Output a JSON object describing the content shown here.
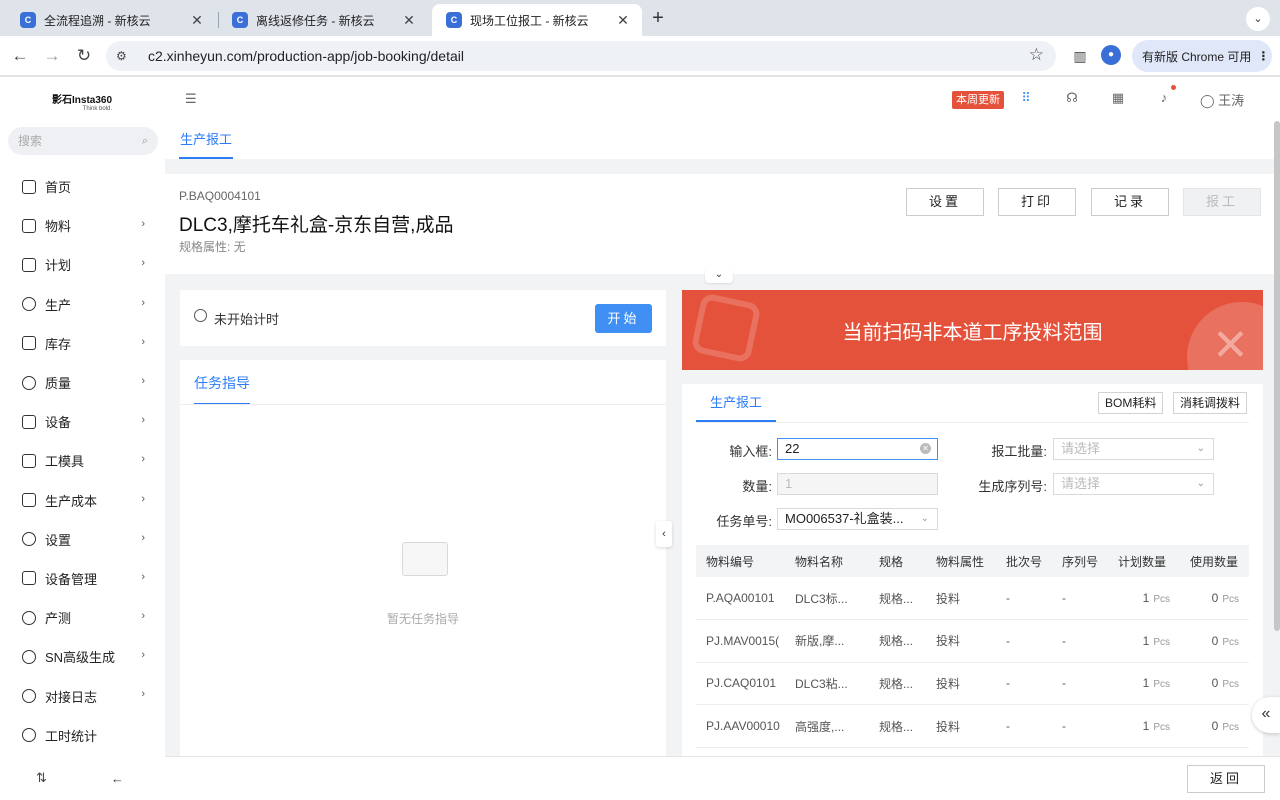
{
  "browser": {
    "tabs": [
      {
        "title": "全流程追溯 - 新核云"
      },
      {
        "title": "离线返修任务 - 新核云"
      },
      {
        "title": "现场工位报工 - 新核云",
        "active": true
      }
    ],
    "url": "c2.xinheyun.com/production-app/job-booking/detail",
    "update_chip": "有新版 Chrome 可用"
  },
  "app": {
    "logo": "影石Insta360",
    "logo_tagline": "Think bold.",
    "search_placeholder": "搜索",
    "menu": [
      {
        "label": "首页",
        "icon": "home-icon"
      },
      {
        "label": "物料",
        "icon": "material-icon"
      },
      {
        "label": "计划",
        "icon": "plan-icon"
      },
      {
        "label": "生产",
        "icon": "wrench-icon"
      },
      {
        "label": "库存",
        "icon": "warehouse-icon"
      },
      {
        "label": "质量",
        "icon": "shield-icon"
      },
      {
        "label": "设备",
        "icon": "device-icon"
      },
      {
        "label": "工模具",
        "icon": "tool-icon"
      },
      {
        "label": "生产成本",
        "icon": "cost-icon"
      },
      {
        "label": "设置",
        "icon": "gear-icon"
      },
      {
        "label": "设备管理",
        "icon": "device-mgmt-icon"
      },
      {
        "label": "产测",
        "icon": "test-icon"
      },
      {
        "label": "SN高级生成",
        "icon": "sn-icon"
      },
      {
        "label": "对接日志",
        "icon": "log-icon"
      },
      {
        "label": "工时统计",
        "icon": "clock-icon"
      }
    ],
    "week_update": "本周更新",
    "user_name": "王涛"
  },
  "page": {
    "tab": "生产报工",
    "product_code": "P.BAQ0004101",
    "product_title": "DLC3,摩托车礼盒-京东自营,成品",
    "spec": "规格属性: 无",
    "buttons": {
      "settings": "设置",
      "print": "打印",
      "record": "记录",
      "report": "报工"
    },
    "timer_label": "未开始计时",
    "start_button": "开始",
    "guide_tab": "任务指导",
    "guide_empty": "暂无任务指导",
    "error_message": "当前扫码非本道工序投料范围",
    "report_tab": "生产报工",
    "bom_button": "BOM耗料",
    "adjust_button": "消耗调拨料",
    "form": {
      "input_label": "输入框:",
      "input_value": "22",
      "qty_label": "数量:",
      "qty_value": "1",
      "task_label": "任务单号:",
      "task_value": "MO006537-礼盒装...",
      "batch_label": "报工批量:",
      "batch_placeholder": "请选择",
      "serial_label": "生成序列号:",
      "serial_placeholder": "请选择"
    },
    "table": {
      "headers": [
        "物料编号",
        "物料名称",
        "规格",
        "物料属性",
        "批次号",
        "序列号",
        "计划数量",
        "使用数量"
      ],
      "rows": [
        {
          "code": "P.AQA00101",
          "name": "DLC3标...",
          "spec": "规格...",
          "attr": "投料",
          "batch": "-",
          "serial": "-",
          "plan": "1",
          "used": "0",
          "unit": "Pcs"
        },
        {
          "code": "PJ.MAV0015(",
          "name": "新版,摩...",
          "spec": "规格...",
          "attr": "投料",
          "batch": "-",
          "serial": "-",
          "plan": "1",
          "used": "0",
          "unit": "Pcs"
        },
        {
          "code": "PJ.CAQ0101",
          "name": "DLC3粘...",
          "spec": "规格...",
          "attr": "投料",
          "batch": "-",
          "serial": "-",
          "plan": "1",
          "used": "0",
          "unit": "Pcs"
        },
        {
          "code": "PJ.AAV00010",
          "name": "高强度,...",
          "spec": "规格...",
          "attr": "投料",
          "batch": "-",
          "serial": "-",
          "plan": "1",
          "used": "0",
          "unit": "Pcs"
        }
      ]
    },
    "back_button": "返回"
  }
}
